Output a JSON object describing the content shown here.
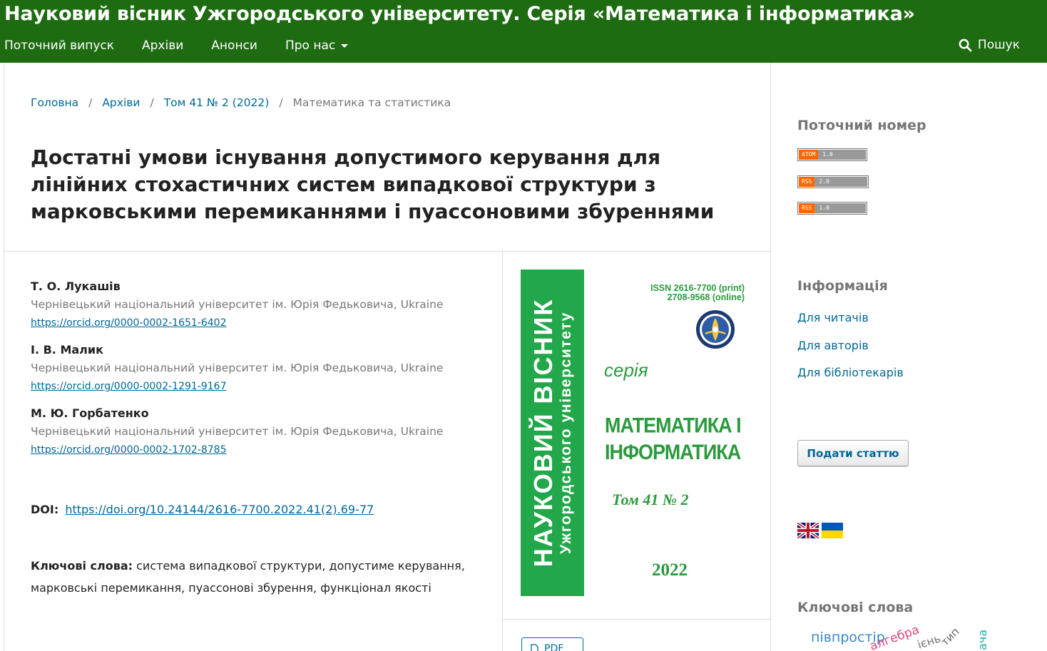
{
  "header": {
    "site_title": "Науковий вісник Ужгородського університету. Серія «Математика і інформатика»",
    "nav": [
      "Поточний випуск",
      "Архіви",
      "Анонси",
      "Про нас"
    ],
    "search_label": "Пошук"
  },
  "breadcrumb": {
    "home": "Головна",
    "archives": "Архіви",
    "issue": "Том 41 № 2 (2022)",
    "section": "Математика та статистика",
    "separator": "/"
  },
  "article": {
    "title": "Достатні умови існування допустимого керування для лінійних стохастичних систем випадкової структури з марковськими перемиканнями і пуассоновими збуреннями",
    "authors": [
      {
        "name": "Т. О. Лукашів",
        "affiliation": "Чернівецький національний університет ім. Юрія Федьковича, Ukraine",
        "orcid": "https://orcid.org/0000-0002-1651-6402"
      },
      {
        "name": "І. В. Малик",
        "affiliation": "Чернівецький національний університет ім. Юрія Федьковича, Ukraine",
        "orcid": "https://orcid.org/0000-0002-1291-9167"
      },
      {
        "name": "М. Ю. Горбатенко",
        "affiliation": "Чернівецький національний університет ім. Юрія Федьковича, Ukraine",
        "orcid": "https://orcid.org/0000-0002-1702-8785"
      }
    ],
    "doi_label": "DOI:",
    "doi": "https://doi.org/10.24144/2616-7700.2022.41(2).69-77",
    "keywords_label": "Ключові слова:",
    "keywords": "система випадкової структури, допустиме керування, марковські перемикання, пуассонові збурення, функціонал якості",
    "pdf_label": "PDF"
  },
  "cover": {
    "spine_line1": "НАУКОВИЙ ВІСНИК",
    "spine_line2": "Ужгородського університету",
    "issn_print": "ISSN 2616-7700 (print)",
    "issn_online": "2708-9568 (online)",
    "series_word": "серія",
    "series_line1": "МАТЕМАТИКА І",
    "series_line2": "ІНФОРМАТИКА",
    "volume": "Том 41  № 2",
    "year": "2022",
    "colors": {
      "green": "#22a84a",
      "text_green": "#2a9a3c"
    }
  },
  "sidebar": {
    "current_issue_heading": "Поточний номер",
    "feeds": [
      {
        "kind": "ATOM",
        "version": "1.0"
      },
      {
        "kind": "RSS",
        "version": "2.0"
      },
      {
        "kind": "RSS",
        "version": "1.0"
      }
    ],
    "info_heading": "Інформація",
    "info_links": [
      "Для читачів",
      "Для авторів",
      "Для бібліотекарів"
    ],
    "submit_label": "Подати статтю",
    "languages": [
      "en-flag-icon",
      "uk-flag-icon"
    ],
    "keywords_heading": "Ключові слова",
    "tag_cloud": [
      "півпростір",
      "алгебра",
      "ієнь",
      "тип",
      "ача"
    ]
  },
  "colors": {
    "header_bg": "#1e6b12",
    "link": "#006798"
  }
}
